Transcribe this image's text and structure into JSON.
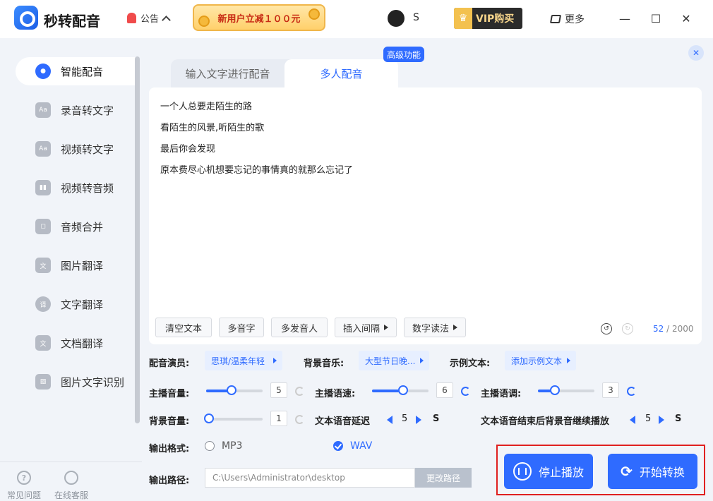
{
  "app": {
    "title": "秒转配音"
  },
  "header": {
    "notice_label": "公告",
    "promo_text": "新用户立减１００元",
    "username": "S",
    "vip_label": "VIP购买",
    "more_label": "更多",
    "minimize": "—",
    "maximize": "☐",
    "close": "✕"
  },
  "sidebar": {
    "items": [
      {
        "label": "智能配音",
        "icon": "mic-icon"
      },
      {
        "label": "录音转文字",
        "icon": "aa-icon"
      },
      {
        "label": "视频转文字",
        "icon": "video-icon"
      },
      {
        "label": "视频转音频",
        "icon": "audio-wave-icon"
      },
      {
        "label": "音频合并",
        "icon": "merge-icon"
      },
      {
        "label": "图片翻译",
        "icon": "image-translate-icon"
      },
      {
        "label": "文字翻译",
        "icon": "text-translate-icon"
      },
      {
        "label": "文档翻译",
        "icon": "doc-translate-icon"
      },
      {
        "label": "图片文字识别",
        "icon": "ocr-icon"
      }
    ],
    "help_label": "常见问题",
    "service_label": "在线客服"
  },
  "tabs": {
    "tab1": "输入文字进行配音",
    "tab2": "多人配音",
    "badge": "高级功能"
  },
  "editor": {
    "lines": [
      "一个人总要走陌生的路",
      "看陌生的风景,听陌生的歌",
      "最后你会发现",
      "原本费尽心机想要忘记的事情真的就那么忘记了"
    ],
    "tools": {
      "clear": "清空文本",
      "polyphone": "多音字",
      "multi_speaker": "多发音人",
      "insert_interval": "插入间隔",
      "digit_reading": "数字读法"
    },
    "count_current": "52",
    "count_max": " / 2000"
  },
  "settings": {
    "voice_label": "配音演员:",
    "voice_value": "思琪/温柔年轻",
    "bgm_label": "背景音乐:",
    "bgm_value": "大型节日晚...",
    "sample_label": "示例文本:",
    "sample_value": "添加示例文本",
    "host_volume_label": "主播音量:",
    "host_volume_value": "5",
    "host_speed_label": "主播语速:",
    "host_speed_value": "6",
    "host_pitch_label": "主播语调:",
    "host_pitch_value": "3",
    "bg_volume_label": "背景音量:",
    "bg_volume_value": "1",
    "delay_label": "文本语音延迟",
    "delay_value": "5",
    "delay_unit": "S",
    "after_label": "文本语音结束后背景音继续播放",
    "after_value": "5",
    "after_unit": "S",
    "format_label": "输出格式:",
    "format_mp3": "MP3",
    "format_wav": "WAV",
    "path_label": "输出路径:",
    "path_value": "C:\\Users\\Administrator\\desktop",
    "path_button": "更改路径"
  },
  "sliders": {
    "host_volume": 0.45,
    "host_speed": 0.55,
    "host_pitch": 0.3,
    "bg_volume": 0.05
  },
  "actions": {
    "stop": "停止播放",
    "start": "开始转换"
  },
  "colors": {
    "accent": "#2f6bff",
    "highlight": "#e02020"
  }
}
